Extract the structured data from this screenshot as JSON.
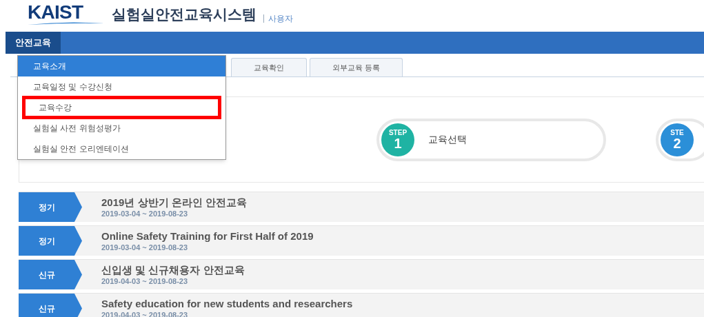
{
  "header": {
    "logo": "KAIST",
    "title": "실험실안전교육시스템",
    "role": "사용자"
  },
  "nav": [
    {
      "label": "안전교육",
      "selected": true
    }
  ],
  "tabs": [
    {
      "label": "교육확인",
      "selected": false
    },
    {
      "label": "외부교육 등록",
      "selected": false
    }
  ],
  "dropdown": [
    {
      "label": "교육소개",
      "selected": true,
      "highlighted": false
    },
    {
      "label": "교육일정 및 수강신청",
      "selected": false,
      "highlighted": false
    },
    {
      "label": "교육수강",
      "selected": false,
      "highlighted": true
    },
    {
      "label": "실험실 사전 위험성평가",
      "selected": false,
      "highlighted": false
    },
    {
      "label": "실험실 안전 오리엔테이션",
      "selected": false,
      "highlighted": false
    }
  ],
  "steps": [
    {
      "tag": "STEP",
      "number": "1",
      "label": "교육선택",
      "color": "#1fb3a3"
    },
    {
      "tag": "STE",
      "number": "2",
      "color": "#2b8fd8"
    }
  ],
  "courses": [
    {
      "badge": "정기",
      "title": "2019년 상반기 온라인 안전교육",
      "period": "2019-03-04 ~ 2019-08-23"
    },
    {
      "badge": "정기",
      "title": "Online Safety Training for First Half of 2019",
      "period": "2019-03-04 ~ 2019-08-23"
    },
    {
      "badge": "신규",
      "title": "신입생 및 신규채용자 안전교육",
      "period": "2019-04-03 ~ 2019-08-23"
    },
    {
      "badge": "신규",
      "title": "Safety education for new students and researchers",
      "period": "2019-04-03 ~ 2019-08-23"
    }
  ]
}
